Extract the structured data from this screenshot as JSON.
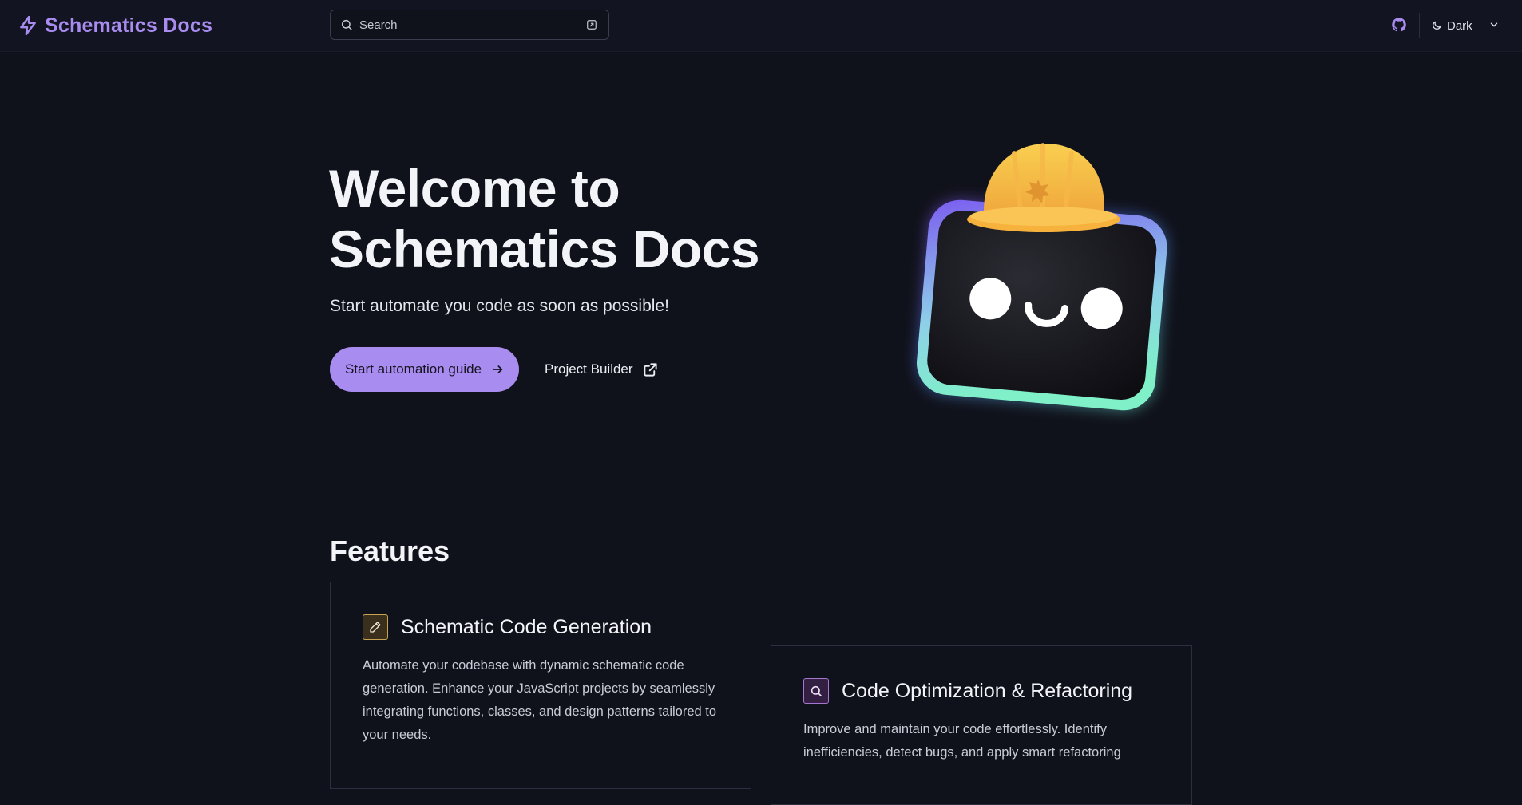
{
  "header": {
    "brand": "Schematics Docs",
    "search_placeholder": "Search",
    "theme_label": "Dark",
    "icons": [
      "bolt-icon",
      "search-icon",
      "keyboard-shortcut-icon",
      "github-icon",
      "moon-icon",
      "chevron-down-icon"
    ]
  },
  "hero": {
    "title_line1": "Welcome to",
    "title_line2": "Schematics Docs",
    "subtitle": "Start automate you code as soon as possible!",
    "primary_button": "Start automation guide",
    "secondary_link": "Project Builder"
  },
  "features": {
    "title": "Features",
    "cards": [
      {
        "title": "Schematic Code Generation",
        "icon": "pencil-icon",
        "body": "Automate your codebase with dynamic schematic code generation. Enhance your JavaScript projects by seamlessly integrating functions, classes, and design patterns tailored to your needs."
      },
      {
        "title": "Code Optimization & Refactoring",
        "icon": "search-icon",
        "body": "Improve and maintain your code effortlessly. Identify inefficiencies, detect bugs, and apply smart refactoring"
      }
    ]
  },
  "colors": {
    "background": "#10121b",
    "accent": "#a98cf0",
    "header": "#121421"
  }
}
